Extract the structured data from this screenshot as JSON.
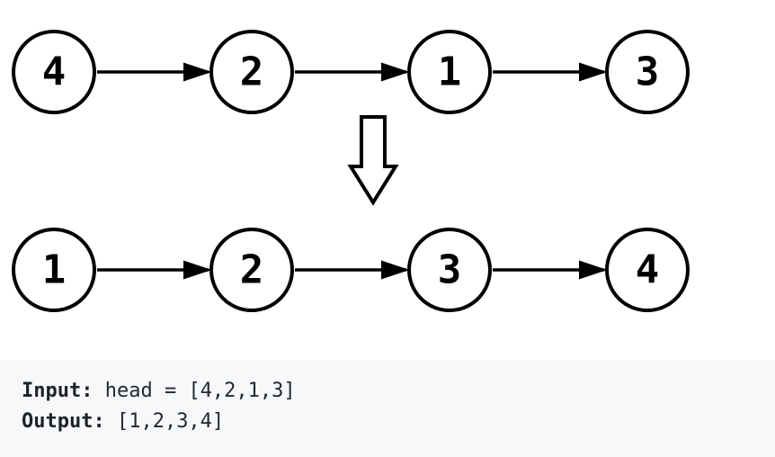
{
  "diagram": {
    "input_list": {
      "nodes": [
        "4",
        "2",
        "1",
        "3"
      ]
    },
    "output_list": {
      "nodes": [
        "1",
        "2",
        "3",
        "4"
      ]
    }
  },
  "io": {
    "input_label": "Input:",
    "input_value": " head = [4,2,1,3]",
    "output_label": "Output:",
    "output_value": " [1,2,3,4]"
  }
}
